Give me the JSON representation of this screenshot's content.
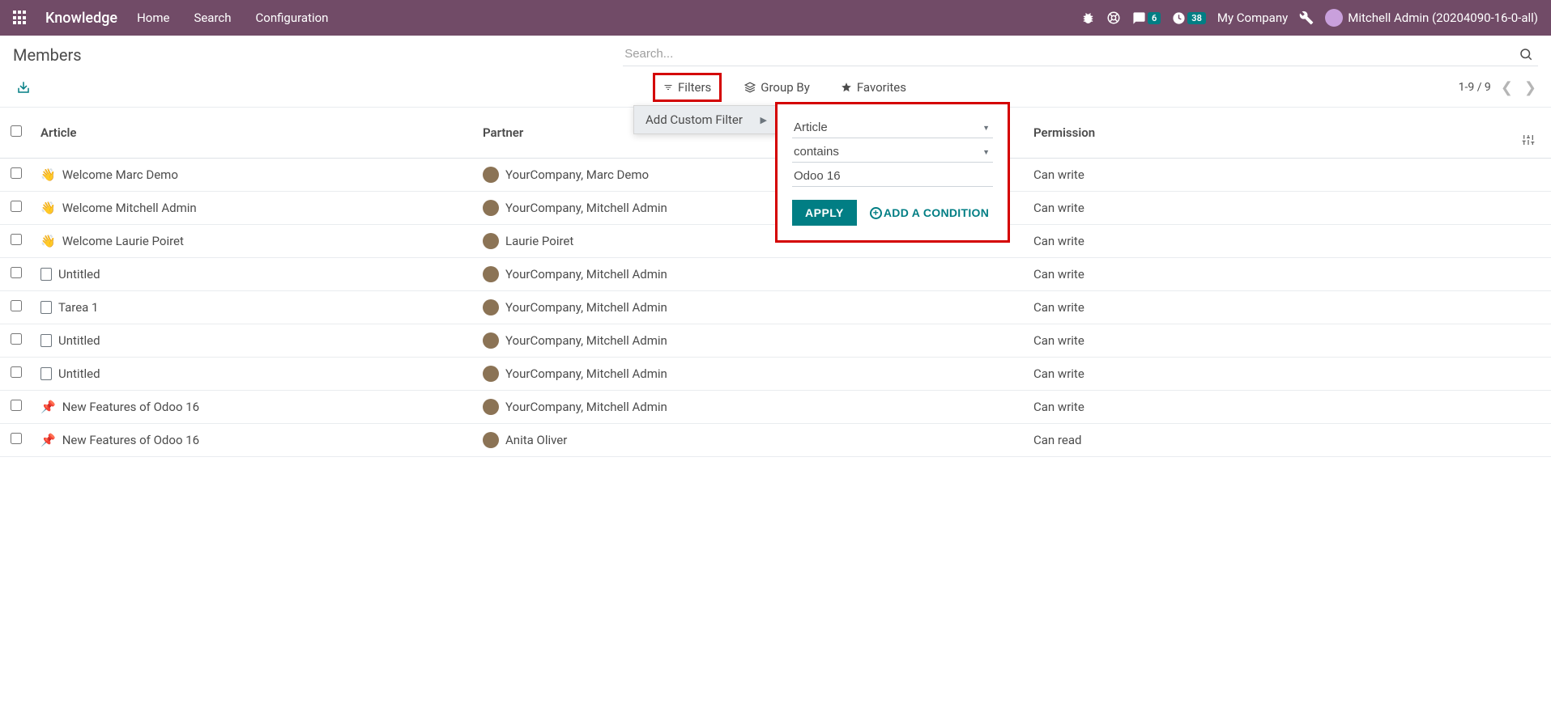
{
  "navbar": {
    "brand": "Knowledge",
    "links": [
      "Home",
      "Search",
      "Configuration"
    ],
    "messages_badge": "6",
    "activities_badge": "38",
    "company": "My Company",
    "user": "Mitchell Admin (20204090-16-0-all)"
  },
  "control_panel": {
    "title": "Members",
    "search_placeholder": "Search...",
    "filters_label": "Filters",
    "group_by_label": "Group By",
    "favorites_label": "Favorites",
    "pager": "1-9 / 9"
  },
  "filter_dropdown": {
    "add_custom": "Add Custom Filter"
  },
  "custom_filter": {
    "field": "Article",
    "operator": "contains",
    "value": "Odoo 16",
    "apply": "APPLY",
    "add_condition": "ADD A CONDITION"
  },
  "table": {
    "headers": {
      "article": "Article",
      "partner": "Partner",
      "permission": "Permission"
    },
    "rows": [
      {
        "icon": "wave",
        "article": "Welcome Marc Demo",
        "partner": "YourCompany, Marc Demo",
        "permission": "Can write"
      },
      {
        "icon": "wave",
        "article": "Welcome Mitchell Admin",
        "partner": "YourCompany, Mitchell Admin",
        "permission": "Can write"
      },
      {
        "icon": "wave",
        "article": "Welcome Laurie Poiret",
        "partner": "Laurie Poiret",
        "permission": "Can write"
      },
      {
        "icon": "doc",
        "article": "Untitled",
        "partner": "YourCompany, Mitchell Admin",
        "permission": "Can write"
      },
      {
        "icon": "doc",
        "article": "Tarea 1",
        "partner": "YourCompany, Mitchell Admin",
        "permission": "Can write"
      },
      {
        "icon": "doc",
        "article": "Untitled",
        "partner": "YourCompany, Mitchell Admin",
        "permission": "Can write"
      },
      {
        "icon": "doc",
        "article": "Untitled",
        "partner": "YourCompany, Mitchell Admin",
        "permission": "Can write"
      },
      {
        "icon": "pin",
        "article": "New Features of Odoo 16",
        "partner": "YourCompany, Mitchell Admin",
        "permission": "Can write"
      },
      {
        "icon": "pin",
        "article": "New Features of Odoo 16",
        "partner": "Anita Oliver",
        "permission": "Can read"
      }
    ]
  }
}
